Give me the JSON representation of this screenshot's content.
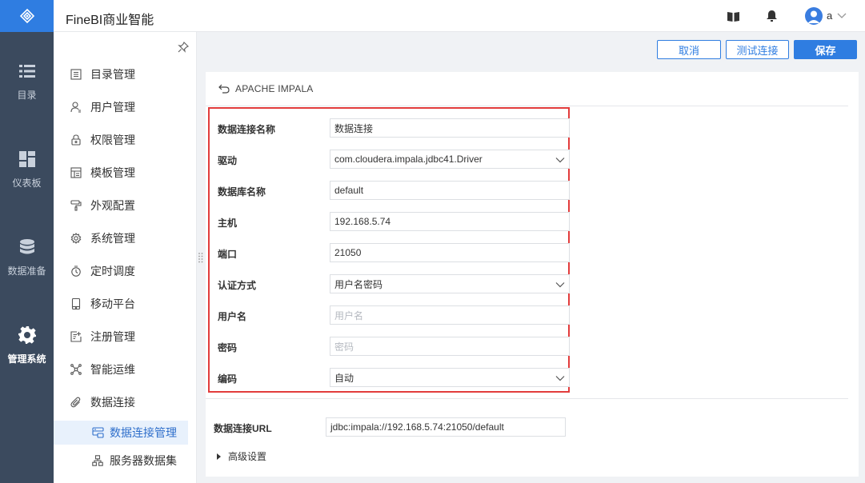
{
  "app": {
    "title": "FineBI商业智能"
  },
  "rail": {
    "items": [
      {
        "label": "目录",
        "icon": "list-icon"
      },
      {
        "label": "仪表板",
        "icon": "dashboard-icon"
      },
      {
        "label": "数据准备",
        "icon": "database-icon"
      },
      {
        "label": "管理系统",
        "icon": "gear-icon",
        "active": true
      }
    ]
  },
  "header": {
    "user": "a"
  },
  "sidebar": {
    "items": [
      {
        "label": "目录管理",
        "icon": "catalog-icon"
      },
      {
        "label": "用户管理",
        "icon": "user-icon"
      },
      {
        "label": "权限管理",
        "icon": "lock-icon"
      },
      {
        "label": "模板管理",
        "icon": "template-icon"
      },
      {
        "label": "外观配置",
        "icon": "paint-roller-icon"
      },
      {
        "label": "系统管理",
        "icon": "settings-icon"
      },
      {
        "label": "定时调度",
        "icon": "timer-icon"
      },
      {
        "label": "移动平台",
        "icon": "mobile-icon"
      },
      {
        "label": "注册管理",
        "icon": "register-icon"
      },
      {
        "label": "智能运维",
        "icon": "network-icon"
      },
      {
        "label": "数据连接",
        "icon": "paperclip-icon"
      }
    ],
    "sub_items": [
      {
        "label": "数据连接管理",
        "icon": "db-connection-icon",
        "active": true
      },
      {
        "label": "服务器数据集",
        "icon": "server-dataset-icon"
      }
    ]
  },
  "toolbar": {
    "cancel_label": "取消",
    "test_label": "测试连接",
    "save_label": "保存"
  },
  "connection": {
    "type_title": "APACHE IMPALA",
    "fields": [
      {
        "label": "数据连接名称",
        "value": "数据连接",
        "kind": "text"
      },
      {
        "label": "驱动",
        "value": "com.cloudera.impala.jdbc41.Driver",
        "kind": "select"
      },
      {
        "label": "数据库名称",
        "value": "default",
        "kind": "text"
      },
      {
        "label": "主机",
        "value": "192.168.5.74",
        "kind": "text"
      },
      {
        "label": "端口",
        "value": "21050",
        "kind": "text"
      },
      {
        "label": "认证方式",
        "value": "用户名密码",
        "kind": "select"
      },
      {
        "label": "用户名",
        "placeholder": "用户名",
        "kind": "text"
      },
      {
        "label": "密码",
        "placeholder": "密码",
        "kind": "password"
      },
      {
        "label": "编码",
        "value": "自动",
        "kind": "select"
      }
    ],
    "url_label": "数据连接URL",
    "url_value": "jdbc:impala://192.168.5.74:21050/default",
    "advanced_label": "高级设置"
  },
  "colors": {
    "accent": "#2f7de1",
    "rail": "#3b4a5e",
    "highlight": "#e23c3c"
  }
}
